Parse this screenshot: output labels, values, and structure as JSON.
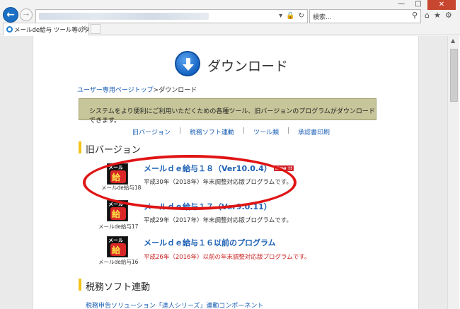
{
  "browser": {
    "search_placeholder": "検索...",
    "tab_title": "メールde給与 ツール等のダウ...",
    "tab_close": "×",
    "window_minimize": "—",
    "window_maximize": "□",
    "window_close": "✕"
  },
  "page": {
    "title": "ダウンロード",
    "breadcrumb": {
      "link": "ユーザー専用ページトップ",
      "separator": ">",
      "current": "ダウンロード"
    },
    "notice": "システムをより便利にご利用いただくための各種ツール、旧バージョンのプログラムがダウンロードできます。",
    "subnav": [
      "旧バージョン",
      "税務ソフト連動",
      "ツール類",
      "承認書印刷"
    ],
    "subnav_separator": "|",
    "sections": [
      {
        "heading": "旧バージョン",
        "products": [
          {
            "title": "メールｄｅ給与１８（Ver10.0.4）",
            "badge": "New !!",
            "caption": "メールde給与18",
            "description": "平成30年（2018年）年末調整対応版プログラムです。",
            "icon_label": "メール",
            "icon_char": "給"
          },
          {
            "title": "メールｄｅ給与１７（Ver9.0.11）",
            "caption": "メールde給与17",
            "description": "平成29年（2017年）年末調整対応版プログラムです。",
            "icon_label": "メール",
            "icon_char": "給"
          },
          {
            "title": "メールｄｅ給与１６以前のプログラム",
            "caption": "メールde給与16",
            "description": "平成26年（2016年）以前の年末調整対応版プログラムです。",
            "icon_label": "メール",
            "icon_char": "給"
          }
        ]
      },
      {
        "heading": "税務ソフト連動",
        "snippet": "税務申告ソリューション「達人シリーズ」連動コンポーネント"
      }
    ]
  },
  "colors": {
    "link": "#1a5fb4",
    "notice_bg": "#c6c69a",
    "section_marker": "#f2c318",
    "annotation_oval": "#e01414",
    "red_text": "#cc2222"
  }
}
